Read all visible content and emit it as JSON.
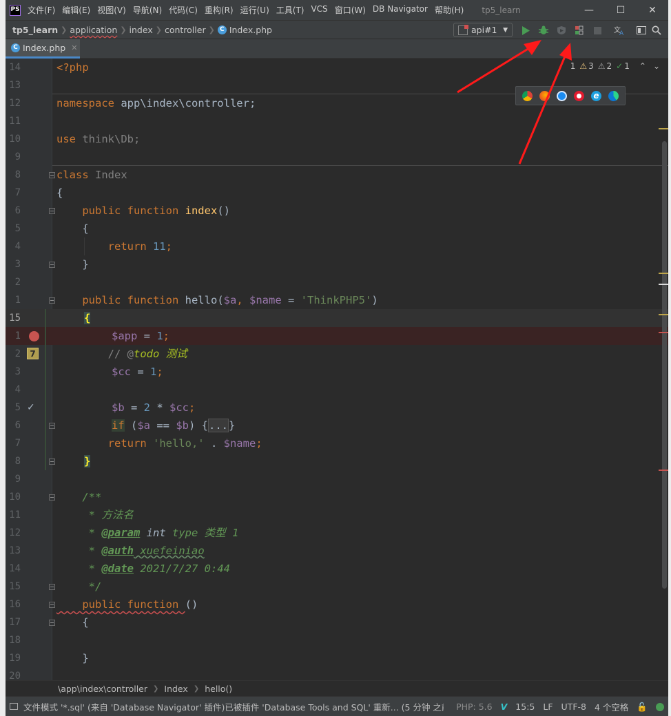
{
  "titlebar": {
    "logo": "PS",
    "menu": [
      "文件(F)",
      "编辑(E)",
      "视图(V)",
      "导航(N)",
      "代码(C)",
      "重构(R)",
      "运行(U)",
      "工具(T)",
      "VCS",
      "窗口(W)",
      "DB Navigator",
      "帮助(H)"
    ],
    "project_title": "tp5_learn",
    "window_buttons": [
      "minimize-icon",
      "maximize-icon",
      "close-icon"
    ]
  },
  "navbar": {
    "breadcrumbs": [
      "tp5_learn",
      "application",
      "index",
      "controller",
      "Index.php"
    ],
    "run_config": "api#1",
    "toolbar_icons": [
      "run-icon",
      "debug-icon",
      "coverage-icon",
      "profile-icon",
      "stop-icon",
      "translate-icon",
      "layout-icon",
      "search-icon"
    ]
  },
  "tabs": [
    {
      "label": "Index.php",
      "close": "✕"
    }
  ],
  "inspections": {
    "typo": "1",
    "warnings": "3",
    "weak_warnings": "2",
    "ok": "1"
  },
  "browsers": [
    "chrome-icon",
    "firefox-icon",
    "safari-icon",
    "opera-icon",
    "ie-icon",
    "edge-icon"
  ],
  "line_numbers": [
    "14",
    "13",
    "12",
    "11",
    "10",
    "9",
    "8",
    "7",
    "6",
    "5",
    "4",
    "3",
    "2",
    "1",
    "15",
    "1",
    "2",
    "3",
    "4",
    "5",
    "6",
    "7",
    "8",
    "9",
    "10",
    "11",
    "12",
    "13",
    "14",
    "15",
    "16",
    "17",
    "18",
    "19",
    "20"
  ],
  "code": {
    "l0": "<?php",
    "l2a": "namespace",
    "l2b": " app\\index\\controller;",
    "l4a": "use",
    "l4b": " think\\Db;",
    "l6a": "class",
    "l6b": " Index",
    "l7": "{",
    "l8a": "    public function ",
    "l8b": "index",
    "l8c": "()",
    "l9": "    {",
    "l10a": "        return ",
    "l10b": "11",
    "l10c": ";",
    "l11": "    }",
    "l13a": "    public function ",
    "l13b": "hello",
    "l13c": "(",
    "l13d": "$a",
    "l13e": ", ",
    "l13f": "$name",
    "l13g": " = ",
    "l13h": "'ThinkPHP5'",
    "l13i": ")",
    "l14": "{",
    "l15a": "$app",
    "l15b": " = ",
    "l15c": "1",
    "l15d": ";",
    "l16a": "        // @",
    "l16b": "todo 测试",
    "l17a": "$cc",
    "l17b": " = ",
    "l17c": "1",
    "l17d": ";",
    "l19a": "$b",
    "l19b": " = ",
    "l19c": "2",
    "l19d": " * ",
    "l19e": "$cc",
    "l19f": ";",
    "l20a": "if",
    "l20b": " (",
    "l20c": "$a",
    "l20d": " == ",
    "l20e": "$b",
    "l20f": ") {",
    "l20g": "...",
    "l20h": "}",
    "l21a": "        return ",
    "l21b": "'hello,'",
    "l21c": " . ",
    "l21d": "$name",
    "l21e": ";",
    "l22": "}",
    "l24": "    /**",
    "l25": "     * 方法名",
    "l26a": "     * ",
    "l26b": "@param",
    "l26c": " int",
    "l26d": " type 类型 1",
    "l27a": "     * ",
    "l27b": "@auth",
    "l27c": " xuefeiniao",
    "l28a": "     * ",
    "l28b": "@date",
    "l28c": " 2021/7/27 0:44",
    "l29": "     */",
    "l30a": "    public function ",
    "l30b": "()",
    "l31": "    {",
    "l33": "    }"
  },
  "bookmark": "7",
  "bottom_breadcrumbs": [
    "\\app\\index\\controller",
    "Index",
    "hello()"
  ],
  "statusbar": {
    "message": "文件模式 '*.sql' (来自 'Database Navigator' 插件)已被插件 'Database Tools and SQL' 重新... (5 分钟 之前)",
    "php": "PHP: 5.6",
    "position": "15:5",
    "line_sep": "LF",
    "encoding": "UTF-8",
    "indent": "4 个空格"
  },
  "colors": {
    "keyword": "#cc7832",
    "function": "#ffc66d",
    "variable": "#9876aa",
    "string": "#6a8759",
    "number": "#6897bb",
    "annotation_arrow": "#ff1a1a"
  }
}
